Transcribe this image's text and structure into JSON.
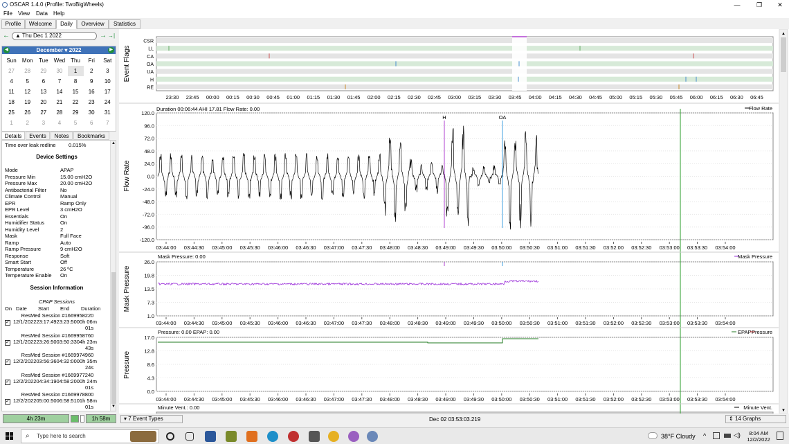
{
  "window": {
    "title": "OSCAR 1.4.0 (Profile: TwoBigWheels)",
    "minimize": "—",
    "restore": "❐",
    "close": "✕"
  },
  "menu": [
    "File",
    "View",
    "Data",
    "Help"
  ],
  "tabs": [
    "Profile",
    "Welcome",
    "Daily",
    "Overview",
    "Statistics"
  ],
  "active_tab": "Daily",
  "datebar": {
    "date": "Thu Dec 1 2022",
    "back": "←",
    "forward": "→",
    "last": "→|"
  },
  "calendar": {
    "month": "December ▾",
    "year": "2022",
    "weekdays": [
      "Sun",
      "Mon",
      "Tue",
      "Wed",
      "Thu",
      "Fri",
      "Sat"
    ],
    "weeks": [
      [
        "27",
        "28",
        "29",
        "30",
        "1",
        "2",
        "3"
      ],
      [
        "4",
        "5",
        "6",
        "7",
        "8",
        "9",
        "10"
      ],
      [
        "11",
        "12",
        "13",
        "14",
        "15",
        "16",
        "17"
      ],
      [
        "18",
        "19",
        "20",
        "21",
        "22",
        "23",
        "24"
      ],
      [
        "25",
        "26",
        "27",
        "28",
        "29",
        "30",
        "31"
      ],
      [
        "1",
        "2",
        "3",
        "4",
        "5",
        "6",
        "7"
      ]
    ],
    "muted_first_week_count": 4,
    "selected": "1"
  },
  "left_tabs": [
    "Details",
    "Events",
    "Notes",
    "Bookmarks"
  ],
  "details": {
    "leak_label": "Time over leak redline",
    "leak_value": "0.015%",
    "device_settings_title": "Device Settings",
    "settings": [
      [
        "Mode",
        "APAP"
      ],
      [
        "Pressure Min",
        "15.00 cmH2O"
      ],
      [
        "Pressure Max",
        "20.00 cmH2O"
      ],
      [
        "Antibacterial Filter",
        "No"
      ],
      [
        "Climate Control",
        "Manual"
      ],
      [
        "EPR",
        "Ramp Only"
      ],
      [
        "EPR Level",
        "3 cmH2O"
      ],
      [
        "Essentials",
        "On"
      ],
      [
        "Humidifier Status",
        "On"
      ],
      [
        "Humidity Level",
        "2"
      ],
      [
        "Mask",
        "Full Face"
      ],
      [
        "Ramp",
        "Auto"
      ],
      [
        "Ramp Pressure",
        "9 cmH2O"
      ],
      [
        "Response",
        "Soft"
      ],
      [
        "Smart Start",
        "Off"
      ],
      [
        "Temperature",
        "26 ºC"
      ],
      [
        "Temperature Enable",
        "On"
      ]
    ],
    "session_info_title": "Session Information",
    "cpap_sessions": "CPAP Sessions",
    "session_headers": [
      "On",
      "Date",
      "Start",
      "End",
      "Duration"
    ],
    "sessions": [
      {
        "name": "ResMed Session #1669958220",
        "line": "12/1/202223:17:4923:23:5000h 06m",
        "tail": "01s"
      },
      {
        "name": "ResMed Session #1669958760",
        "line": "12/1/202223:26:5003:50:3304h 23m",
        "tail": "43s"
      },
      {
        "name": "ResMed Session #1669974960",
        "line": "12/2/202203:56:3604:32:0000h 35m",
        "tail": "24s"
      },
      {
        "name": "ResMed Session #1669977240",
        "line": "12/2/202204:34:1904:58:2000h 24m",
        "tail": "01s"
      },
      {
        "name": "ResMed Session #1669978800",
        "line": "12/2/202205:00:5006:58:5101h 58m",
        "tail": "01s"
      }
    ]
  },
  "left_bottom": {
    "left": "4h 23m",
    "right": "1h 58m"
  },
  "event_flags": {
    "ylabel": "Event Flags",
    "rows": [
      "CSR",
      "LL",
      "CA",
      "OA",
      "UA",
      "H",
      "RE"
    ],
    "times": [
      "23:30",
      "23:45",
      "00:00",
      "00:15",
      "00:30",
      "00:45",
      "01:00",
      "01:15",
      "01:30",
      "01:45",
      "02:00",
      "02:15",
      "02:30",
      "02:45",
      "03:00",
      "03:15",
      "03:30",
      "03:45",
      "04:00",
      "04:15",
      "04:30",
      "04:45",
      "05:00",
      "05:15",
      "05:30",
      "05:45",
      "06:00",
      "06:15",
      "06:30",
      "06:45"
    ]
  },
  "flow_rate": {
    "ylabel": "Flow Rate",
    "header": "Duration 00:06:44 AHI 17.81 Flow Rate: 0.00",
    "legend": "Flow Rate",
    "yticks": [
      "120.0",
      "96.0",
      "72.0",
      "48.0",
      "24.0",
      "0.0",
      "-24.0",
      "-48.0",
      "-72.0",
      "-96.0",
      "-120.0"
    ],
    "markers": [
      "H",
      "OA"
    ]
  },
  "mask_pressure": {
    "ylabel": "Mask Pressure",
    "header": "Mask Pressure: 0.00",
    "legend": "Mask Pressure",
    "yticks": [
      "26.0",
      "19.8",
      "13.5",
      "7.3",
      "1.0"
    ]
  },
  "pressure": {
    "ylabel": "Pressure",
    "header": "Pressure: 0.00 EPAP: 0.00",
    "legend_epap": "EPAP",
    "legend_pressure": "Pressure",
    "yticks": [
      "17.0",
      "12.8",
      "8.6",
      "4.3",
      "0.0"
    ]
  },
  "minute_vent": {
    "header": "Minute Vent.: 0.00",
    "legend": "Minute Vent."
  },
  "time_axis": [
    "03:44:00",
    "03:44:30",
    "03:45:00",
    "03:45:30",
    "03:46:00",
    "03:46:30",
    "03:47:00",
    "03:47:30",
    "03:48:00",
    "03:48:30",
    "03:49:00",
    "03:49:30",
    "03:50:00",
    "03:50:30",
    "03:51:00",
    "03:51:30",
    "03:52:00",
    "03:52:30",
    "03:53:00",
    "03:53:30",
    "03:54:00"
  ],
  "statusbar": {
    "event_types": "7 Event Types",
    "timestamp": "Dec 02 03:53:03.219",
    "graphs": "14 Graphs"
  },
  "taskbar": {
    "search_placeholder": "Type here to search",
    "weather": "38°F  Cloudy",
    "time": "8:04 AM",
    "date": "12/2/2022"
  },
  "colors": {
    "flow": "#000000",
    "mask_pressure": "#9b30d9",
    "epap": "#1f7a1f",
    "pressure": "#d02020",
    "h_marker": "#b040d0",
    "oa_marker": "#40a0e0",
    "cursor": "#2a9d2a",
    "event_band": "#d7ead8"
  }
}
